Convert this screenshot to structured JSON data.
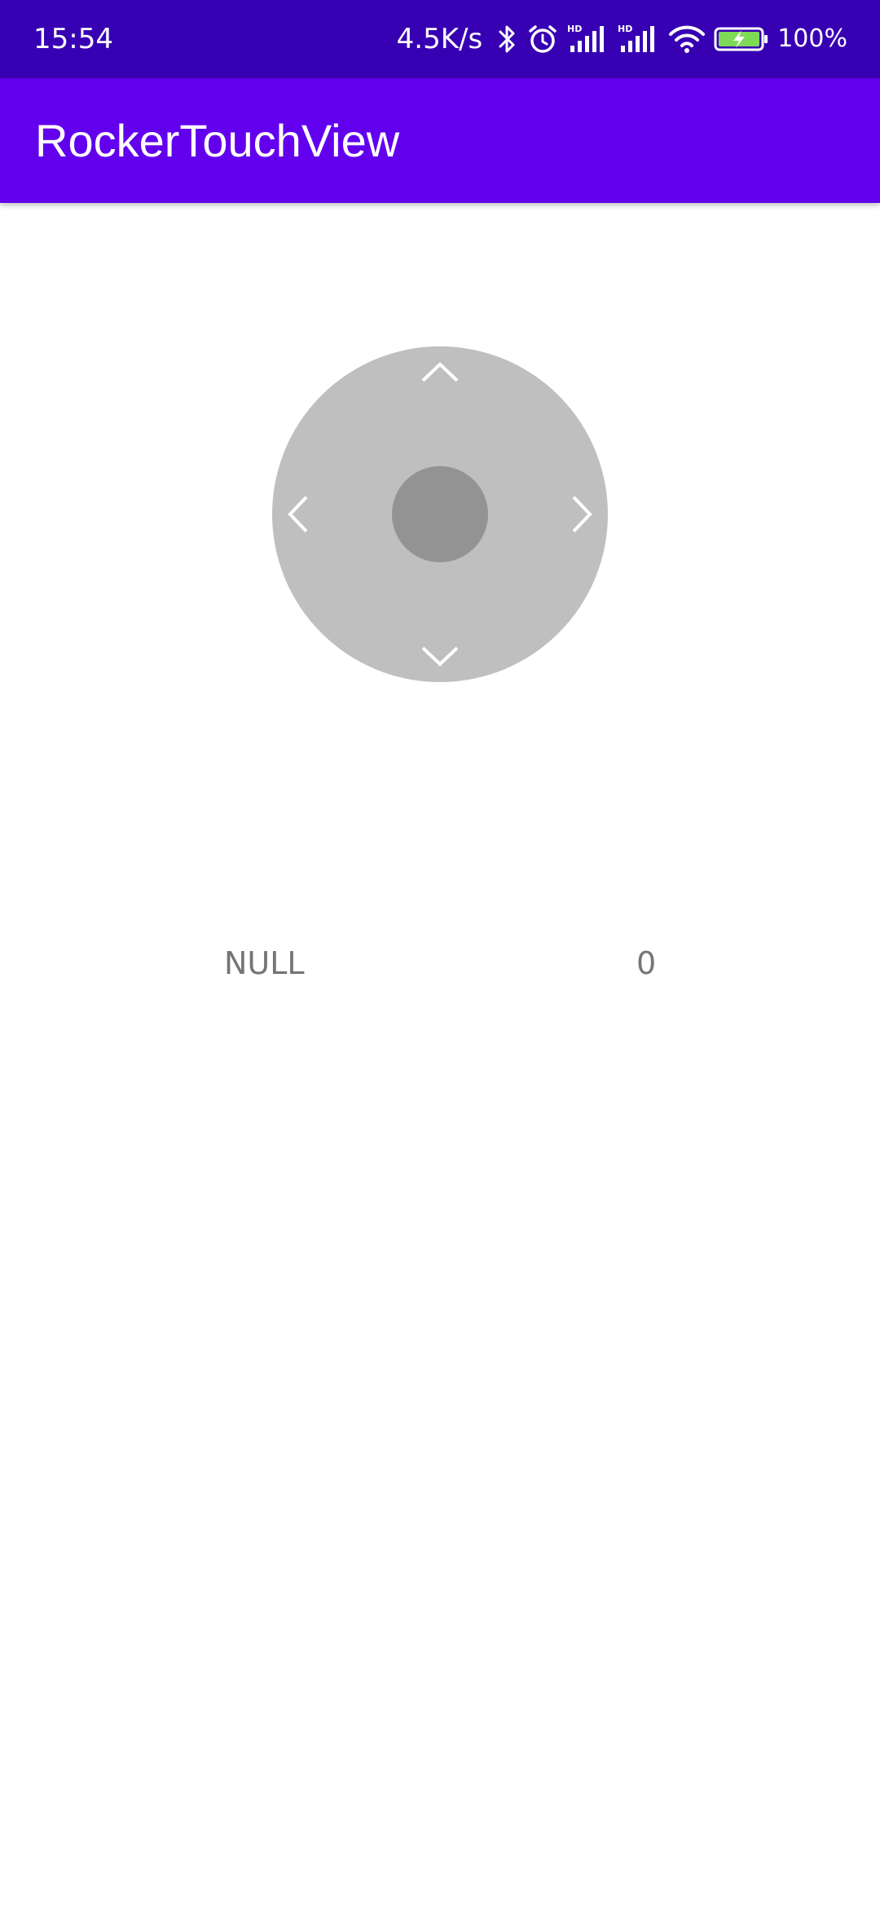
{
  "status_bar": {
    "time": "15:54",
    "net_speed": "4.5K/s",
    "battery_percent": "100%",
    "icons": [
      "bluetooth-icon",
      "alarm-icon",
      "signal-hd-icon",
      "signal-hd-icon",
      "wifi-icon",
      "battery-charging-icon"
    ],
    "background_color": "#3700b3"
  },
  "app_bar": {
    "title": "RockerTouchView",
    "background_color": "#6200ee"
  },
  "rocker": {
    "arrows": [
      "chevron-up-icon",
      "chevron-left-icon",
      "chevron-right-icon",
      "chevron-down-icon"
    ],
    "pad_color": "#bfbfbf",
    "knob_color": "#939393"
  },
  "info": {
    "direction": "NULL",
    "distance": "0"
  }
}
